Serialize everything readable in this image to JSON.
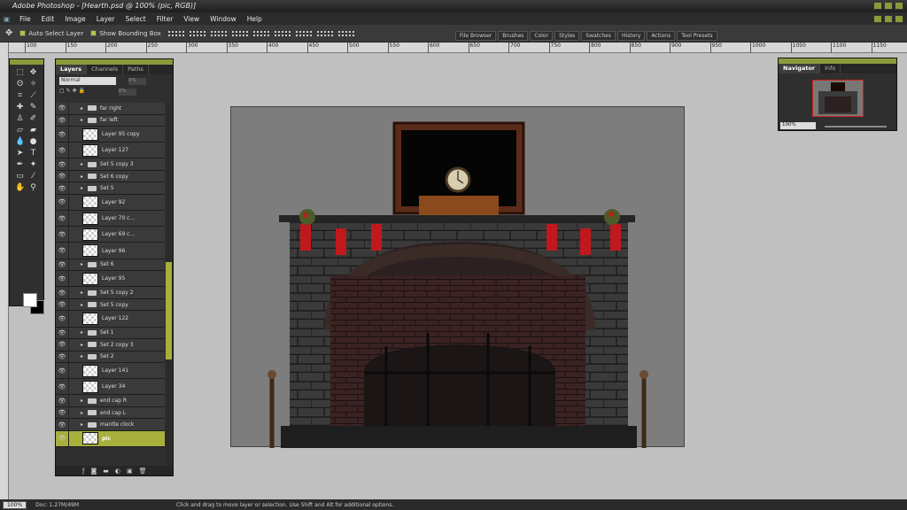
{
  "app": {
    "title": "Adobe Photoshop - [Hearth.psd @ 100% (pic, RGB)]"
  },
  "menu": [
    "File",
    "Edit",
    "Image",
    "Layer",
    "Select",
    "Filter",
    "View",
    "Window",
    "Help"
  ],
  "options_bar": {
    "auto_select": "Auto Select Layer",
    "bounding_box": "Show Bounding Box"
  },
  "palette_wells": [
    "File Browser",
    "Brushes",
    "Color",
    "Styles",
    "Swatches",
    "History",
    "Actions",
    "Tool Presets"
  ],
  "ruler_ticks": [
    "100",
    "150",
    "200",
    "250",
    "300",
    "350",
    "400",
    "450",
    "500",
    "550",
    "600",
    "650",
    "700",
    "750",
    "800",
    "850",
    "900",
    "950",
    "1000",
    "1050",
    "1100",
    "1150"
  ],
  "layers_panel": {
    "tabs": [
      "Layers",
      "Channels",
      "Paths"
    ],
    "blend_mode": "Normal",
    "opacity": "0%",
    "fill": "0%",
    "rows": [
      {
        "name": "far right",
        "type": "folder"
      },
      {
        "name": "far left",
        "type": "folder"
      },
      {
        "name": "Layer 95 copy",
        "type": "layer"
      },
      {
        "name": "Layer 127",
        "type": "layer"
      },
      {
        "name": "Set 5 copy 3",
        "type": "folder"
      },
      {
        "name": "Set 6 copy",
        "type": "folder"
      },
      {
        "name": "Set 5",
        "type": "folder"
      },
      {
        "name": "Layer 92",
        "type": "layer"
      },
      {
        "name": "Layer 70 c...",
        "type": "layer"
      },
      {
        "name": "Layer 69 c...",
        "type": "layer"
      },
      {
        "name": "Layer 96",
        "type": "layer"
      },
      {
        "name": "Set 6",
        "type": "folder"
      },
      {
        "name": "Layer 95",
        "type": "layer"
      },
      {
        "name": "Set 5 copy 2",
        "type": "folder"
      },
      {
        "name": "Set 5 copy",
        "type": "folder"
      },
      {
        "name": "Layer 122",
        "type": "layer"
      },
      {
        "name": "Set 1",
        "type": "folder"
      },
      {
        "name": "Set 2 copy 3",
        "type": "folder"
      },
      {
        "name": "Set 2",
        "type": "folder"
      },
      {
        "name": "Layer 141",
        "type": "layer"
      },
      {
        "name": "Layer 34",
        "type": "layer"
      },
      {
        "name": "end cap R",
        "type": "folder"
      },
      {
        "name": "end cap L",
        "type": "folder"
      },
      {
        "name": "mantle clock",
        "type": "folder"
      },
      {
        "name": "pic",
        "type": "layer",
        "selected": true
      }
    ]
  },
  "navigator": {
    "tabs": [
      "Navigator",
      "Info"
    ],
    "zoom": "100%"
  },
  "status": {
    "zoom": "100%",
    "doc": "Doc: 1.27M/49M",
    "hint": "Click and drag to move layer or selection. Use Shift and Alt for additional options."
  },
  "colors": {
    "accent": "#a7b03c",
    "panel": "#2f2f2f",
    "canvas": "#c0c0c0"
  }
}
